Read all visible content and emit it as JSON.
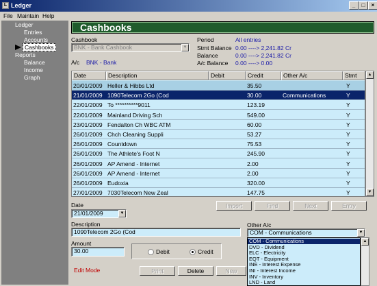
{
  "window": {
    "title": "Ledger",
    "icon": "ledger-app-icon",
    "minimize": "_",
    "maximize": "□",
    "close": "×"
  },
  "menu": [
    "File",
    "Maintain",
    "Help"
  ],
  "sidebar": {
    "items": [
      {
        "label": "Ledger"
      },
      {
        "label": "Entries"
      },
      {
        "label": "Accounts"
      },
      {
        "label": "Cashbooks"
      },
      {
        "label": "Reports"
      },
      {
        "label": "Balance"
      },
      {
        "label": "Income"
      },
      {
        "label": "Graph"
      }
    ]
  },
  "banner": {
    "title": "Cashbooks"
  },
  "cashbook": {
    "label": "Cashbook",
    "value": "BNK - Bank Cashbook"
  },
  "ac": {
    "label": "A/c",
    "value": "BNK - Bank"
  },
  "summary": {
    "period_label": "Period",
    "period_value": "All entries",
    "stmt_label": "Stmt Balance",
    "stmt_value": "0.00 ----> 2,241.82  Cr",
    "bal_label": "Balance",
    "bal_value": "0.00 ----> 2,241.82  Cr",
    "acbal_label": "A/c Balance",
    "acbal_value": "0.00 ----> 0.00"
  },
  "grid": {
    "headers": [
      "Date",
      "Description",
      "Debit",
      "Credit",
      "Other A/c",
      "Stmt"
    ],
    "rows": [
      [
        "20/01/2009",
        "Heller & Hibbs Ltd",
        "",
        "35.50",
        "",
        "Y"
      ],
      [
        "21/01/2009",
        "1090Telecom 2Go (Cod",
        "",
        "30.00",
        "Communications",
        "Y"
      ],
      [
        "22/01/2009",
        "To **********9011",
        "",
        "123.19",
        "",
        "Y"
      ],
      [
        "22/01/2009",
        "Mainland Driving Sch",
        "",
        "549.00",
        "",
        "Y"
      ],
      [
        "23/01/2009",
        "Fendalton Ch WBC ATM",
        "",
        "60.00",
        "",
        "Y"
      ],
      [
        "26/01/2009",
        "Chch Cleaning Suppli",
        "",
        "53.27",
        "",
        "Y"
      ],
      [
        "26/01/2009",
        "Countdown",
        "",
        "75.53",
        "",
        "Y"
      ],
      [
        "26/01/2009",
        "The Athlete's Foot N",
        "",
        "245.90",
        "",
        "Y"
      ],
      [
        "26/01/2009",
        "AP Amend - Internet",
        "",
        "2.00",
        "",
        "Y"
      ],
      [
        "26/01/2009",
        "AP Amend - Internet",
        "",
        "2.00",
        "",
        "Y"
      ],
      [
        "26/01/2009",
        "Eudoxia",
        "",
        "320.00",
        "",
        "Y"
      ],
      [
        "27/01/2009",
        "7030Telecom New Zeal",
        "",
        "147.75",
        "",
        "Y"
      ]
    ]
  },
  "nav_buttons": {
    "import": "Import",
    "find": "Find",
    "next": "Next",
    "entry": "Entry"
  },
  "date": {
    "label": "Date",
    "value": "21/01/2009"
  },
  "description": {
    "label": "Description",
    "value": "1090Telecom 2Go (Cod"
  },
  "amount": {
    "label": "Amount",
    "value": "30.00"
  },
  "type": {
    "debit": "Debit",
    "credit": "Credit",
    "selected": "Credit"
  },
  "other_ac": {
    "label": "Other A/c",
    "value": "COM - Communications",
    "options": [
      "COM - Communications",
      "DVD - Dividend",
      "ELC - Electricity",
      "EQT - Equipment",
      "INE - Interest Expense",
      "INI - Interest Income",
      "INV - Inventory",
      "LND - Land"
    ]
  },
  "mode": {
    "text": "Edit Mode",
    "color": "#c00000"
  },
  "actions": {
    "print": "Print",
    "delete": "Delete",
    "new": "New"
  },
  "colors": {
    "selection": "#0a246a",
    "field": "#ccecfa",
    "banner": "#1f5b2c",
    "sidebar": "#808080"
  }
}
